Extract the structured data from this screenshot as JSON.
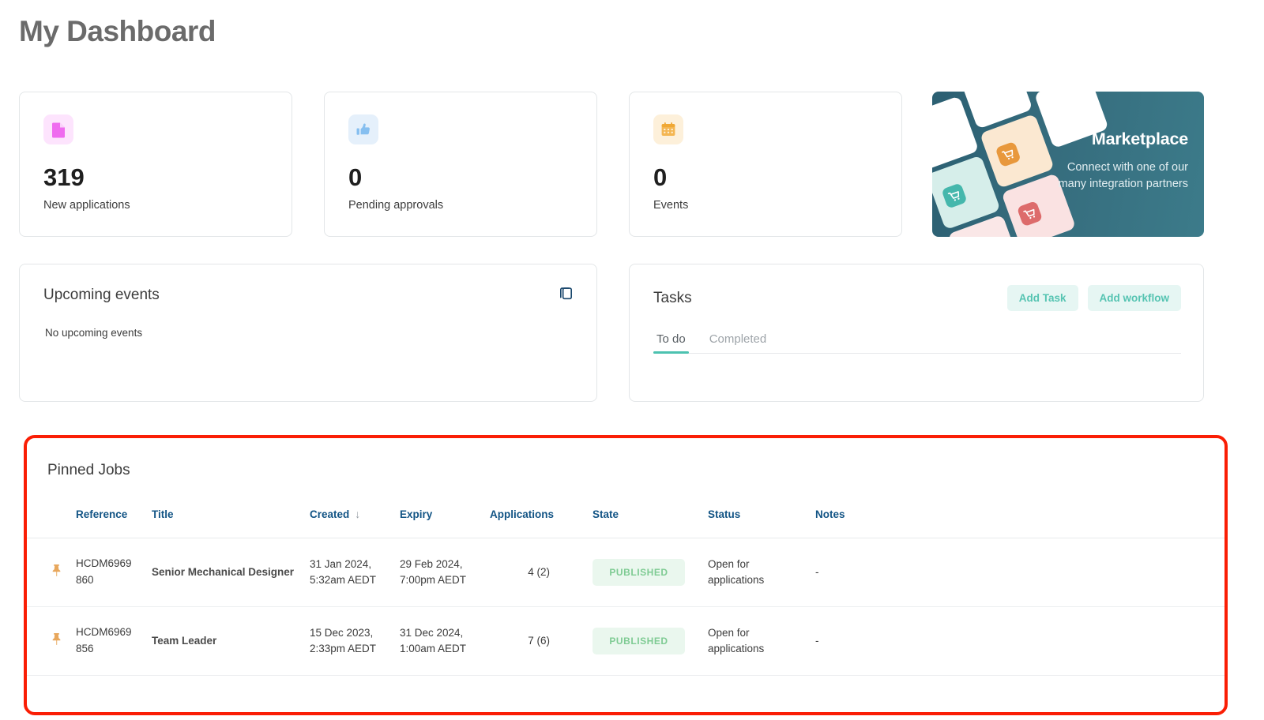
{
  "header": {
    "title": "My Dashboard"
  },
  "stats": [
    {
      "icon": "document-icon",
      "value": "319",
      "label": "New applications",
      "icon_color": "#ef6bef",
      "icon_bg": "#fde4fd"
    },
    {
      "icon": "thumbs-up-icon",
      "value": "0",
      "label": "Pending approvals",
      "icon_color": "#86bff0",
      "icon_bg": "#e5f0fb"
    },
    {
      "icon": "calendar-icon",
      "value": "0",
      "label": "Events",
      "icon_color": "#f4b652",
      "icon_bg": "#fdf0da"
    }
  ],
  "marketplace": {
    "title": "Marketplace",
    "subtitle_line1": "Connect with one of our",
    "subtitle_line2": "many integration partners",
    "bg_color": "#2f6376",
    "tiles": [
      {
        "name": "cart-tile-teal",
        "color": "#45b7ac",
        "bg": "#d6eeea"
      },
      {
        "name": "cart-tile-orange",
        "color": "#e8983c",
        "bg": "#fbe8d1"
      },
      {
        "name": "cart-tile-red",
        "color": "#dd6b6b",
        "bg": "#fae2e2"
      }
    ]
  },
  "events_panel": {
    "title": "Upcoming events",
    "empty_text": "No upcoming events",
    "action_icon": "copy-icon"
  },
  "tasks_panel": {
    "title": "Tasks",
    "add_task_label": "Add Task",
    "add_workflow_label": "Add workflow",
    "tabs": [
      {
        "label": "To do",
        "active": true
      },
      {
        "label": "Completed",
        "active": false
      }
    ],
    "accent_color": "#4cc2b0"
  },
  "pinned_jobs": {
    "title": "Pinned Jobs",
    "highlight_color": "#fa1e05",
    "sort_column": "Created",
    "sort_direction": "↓",
    "columns": [
      "",
      "Reference",
      "Title",
      "Created",
      "Expiry",
      "Applications",
      "State",
      "Status",
      "Notes"
    ],
    "rows": [
      {
        "pin": "pin-icon",
        "reference": "HCDM6969860",
        "reference_line1": "HCDM6969",
        "reference_line2": "860",
        "title": "Senior Mechanical Designer",
        "created_line1": "31 Jan 2024,",
        "created_line2": "5:32am AEDT",
        "expiry_line1": "29 Feb 2024,",
        "expiry_line2": "7:00pm AEDT",
        "applications": "4 (2)",
        "state": "PUBLISHED",
        "status_line1": "Open for",
        "status_line2": "applications",
        "notes": "-"
      },
      {
        "pin": "pin-icon",
        "reference": "HCDM6969856",
        "reference_line1": "HCDM6969",
        "reference_line2": "856",
        "title": "Team Leader",
        "created_line1": "15 Dec 2023,",
        "created_line2": "2:33pm AEDT",
        "expiry_line1": "31 Dec 2024,",
        "expiry_line2": "1:00am AEDT",
        "applications": "7 (6)",
        "state": "PUBLISHED",
        "status_line1": "Open for",
        "status_line2": "applications",
        "notes": "-"
      }
    ]
  }
}
